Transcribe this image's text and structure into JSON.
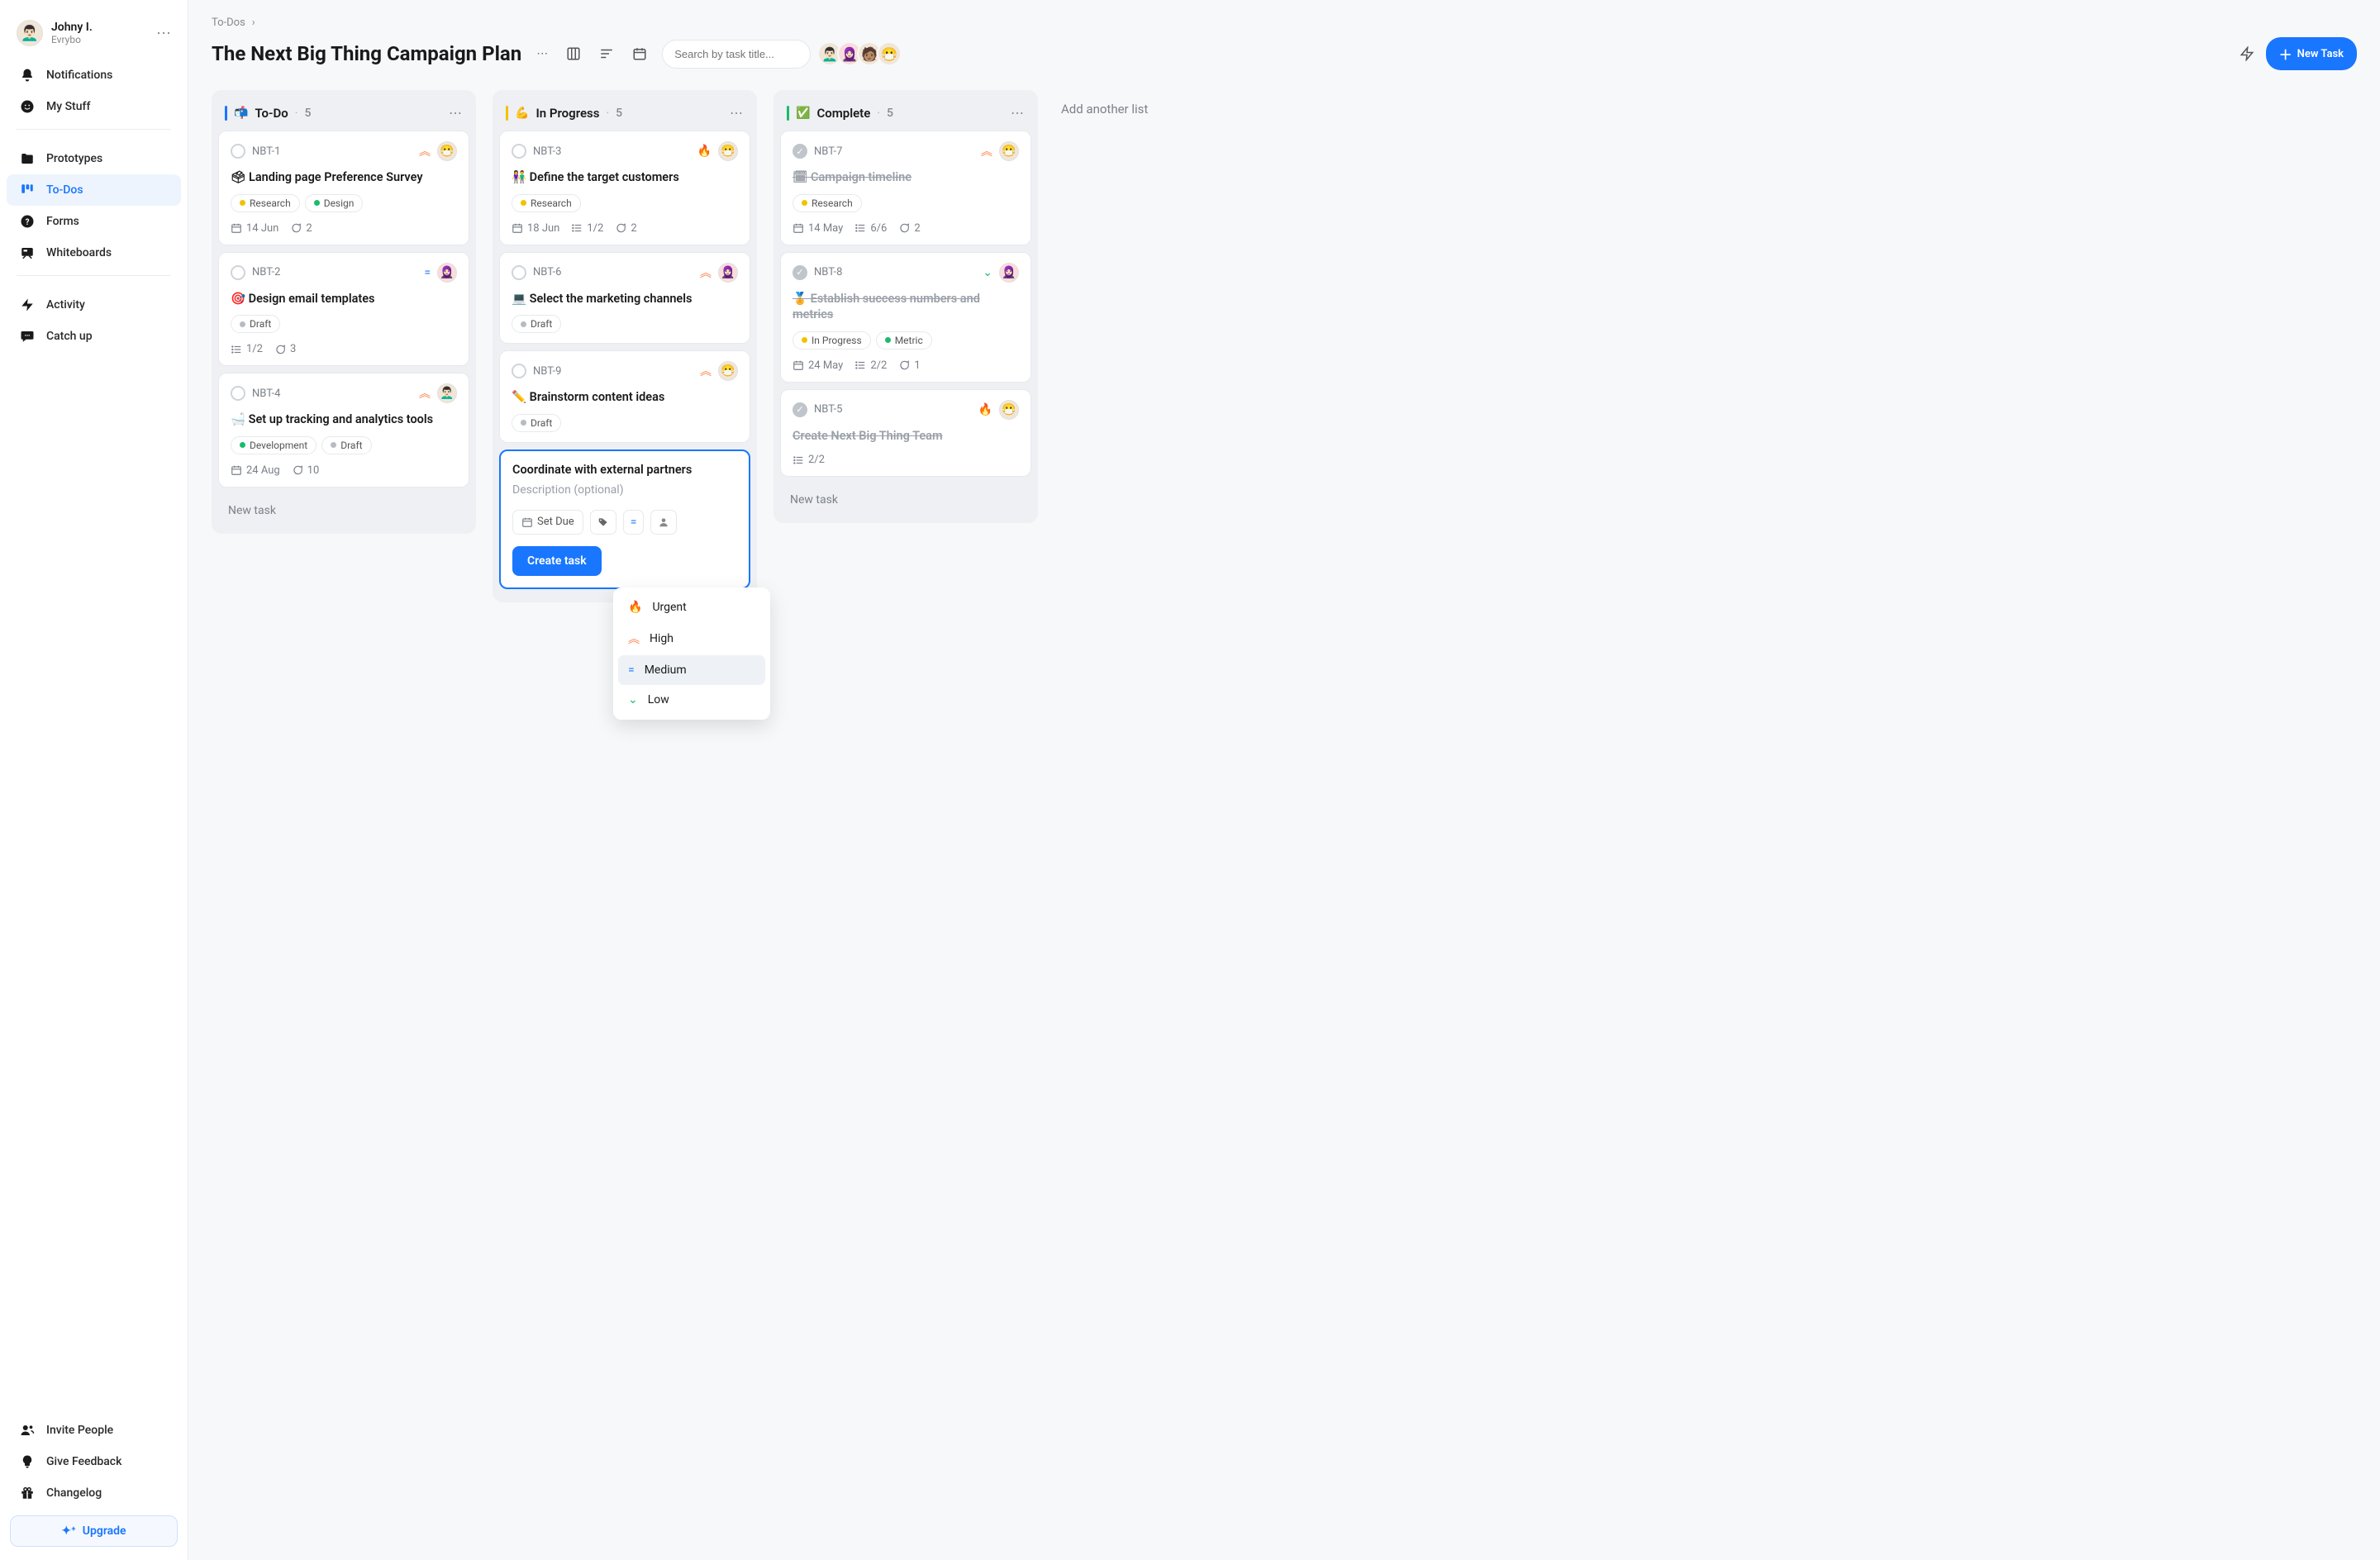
{
  "profile": {
    "name": "Johny I.",
    "org": "Evrybo",
    "emoji": "👨🏻‍🦱"
  },
  "sidebar": {
    "items": [
      {
        "label": "Notifications",
        "icon": "bell"
      },
      {
        "label": "My Stuff",
        "icon": "smile"
      },
      {
        "label": "Prototypes",
        "icon": "folder"
      },
      {
        "label": "To-Dos",
        "icon": "board",
        "active": true
      },
      {
        "label": "Forms",
        "icon": "question"
      },
      {
        "label": "Whiteboards",
        "icon": "whiteboard"
      },
      {
        "label": "Activity",
        "icon": "bolt"
      },
      {
        "label": "Catch up",
        "icon": "chat"
      }
    ],
    "footer": [
      {
        "label": "Invite People",
        "icon": "people"
      },
      {
        "label": "Give Feedback",
        "icon": "bulb"
      },
      {
        "label": "Changelog",
        "icon": "gift"
      }
    ],
    "upgrade": "Upgrade"
  },
  "breadcrumb": {
    "label": "To-Dos"
  },
  "header": {
    "title": "The Next Big Thing Campaign Plan",
    "search_placeholder": "Search by task title...",
    "new_task": "New Task",
    "avatars": [
      "👨🏻‍🦱",
      "🧕🏻",
      "🧑🏽",
      "😷"
    ]
  },
  "columns": [
    {
      "emoji": "📬",
      "title": "To-Do",
      "count": "5",
      "bar": "#1976ff",
      "cards": [
        {
          "id": "NBT-1",
          "title": "🗳 Landing page Preference Survey",
          "prio": "high",
          "prio_icon": "︽",
          "avatar": "😷",
          "tags": [
            {
              "label": "Research",
              "color": "#f2c200"
            },
            {
              "label": "Design",
              "color": "#1abc6b"
            }
          ],
          "meta": [
            {
              "icon": "cal",
              "text": "14 Jun"
            },
            {
              "icon": "comment",
              "text": "2"
            }
          ]
        },
        {
          "id": "NBT-2",
          "title": "🎯 Design email templates",
          "prio": "medium",
          "prio_icon": "=",
          "avatar": "🧕🏻",
          "avatar_red": true,
          "tags": [
            {
              "label": "Draft",
              "color": "#b7bbc2"
            }
          ],
          "meta": [
            {
              "icon": "list",
              "text": "1/2"
            },
            {
              "icon": "comment",
              "text": "3"
            }
          ]
        },
        {
          "id": "NBT-4",
          "title": "🛁 Set up tracking and analytics tools",
          "prio": "high",
          "prio_icon": "︽",
          "avatar": "👨🏻‍🦱",
          "tags": [
            {
              "label": "Development",
              "color": "#1abc6b"
            },
            {
              "label": "Draft",
              "color": "#b7bbc2"
            }
          ],
          "meta": [
            {
              "icon": "cal",
              "text": "24 Aug"
            },
            {
              "icon": "comment",
              "text": "10"
            }
          ]
        }
      ],
      "new_task": "New task"
    },
    {
      "emoji": "💪",
      "title": "In Progress",
      "count": "5",
      "bar": "#f2c200",
      "cards": [
        {
          "id": "NBT-3",
          "title": "👫 Define the target customers",
          "prio": "urgent",
          "prio_icon": "🔥",
          "avatar": "😷",
          "tags": [
            {
              "label": "Research",
              "color": "#f2c200"
            }
          ],
          "meta": [
            {
              "icon": "cal",
              "text": "18 Jun"
            },
            {
              "icon": "list",
              "text": "1/2"
            },
            {
              "icon": "comment",
              "text": "2"
            }
          ]
        },
        {
          "id": "NBT-6",
          "title": "💻 Select the marketing channels",
          "prio": "high",
          "prio_icon": "︽",
          "avatar": "🧕🏻",
          "avatar_red": true,
          "tags": [
            {
              "label": "Draft",
              "color": "#b7bbc2"
            }
          ],
          "meta": []
        },
        {
          "id": "NBT-9",
          "title": "✏️ Brainstorm content ideas",
          "prio": "high",
          "prio_icon": "︽",
          "avatar": "😷",
          "tags": [
            {
              "label": "Draft",
              "color": "#b7bbc2"
            }
          ],
          "meta": []
        }
      ],
      "compose": {
        "title": "Coordinate with external partners",
        "desc_placeholder": "Description (optional)",
        "set_due": "Set Due",
        "create": "Create task",
        "priority_options": [
          {
            "label": "Urgent",
            "class": "urgent",
            "icon": "🔥"
          },
          {
            "label": "High",
            "class": "high",
            "icon": "︽"
          },
          {
            "label": "Medium",
            "class": "medium",
            "icon": "=",
            "selected": true
          },
          {
            "label": "Low",
            "class": "low",
            "icon": "⌄"
          }
        ]
      }
    },
    {
      "emoji": "✅",
      "title": "Complete",
      "count": "5",
      "bar": "#1abc6b",
      "cards": [
        {
          "id": "NBT-7",
          "done": true,
          "title": "🗓 Campaign timeline",
          "prio": "high",
          "prio_icon": "︽",
          "avatar": "😷",
          "tags": [
            {
              "label": "Research",
              "color": "#f2c200"
            }
          ],
          "meta": [
            {
              "icon": "cal",
              "text": "14 May"
            },
            {
              "icon": "list",
              "text": "6/6"
            },
            {
              "icon": "comment",
              "text": "2"
            }
          ]
        },
        {
          "id": "NBT-8",
          "done": true,
          "title": "🏅 Establish success numbers and metrics",
          "prio": "low",
          "prio_icon": "⌄",
          "avatar": "🧕🏻",
          "avatar_red": true,
          "tags": [
            {
              "label": "In Progress",
              "color": "#f2c200"
            },
            {
              "label": "Metric",
              "color": "#1abc6b"
            }
          ],
          "meta": [
            {
              "icon": "cal",
              "text": "24 May"
            },
            {
              "icon": "list",
              "text": "2/2"
            },
            {
              "icon": "comment",
              "text": "1"
            }
          ]
        },
        {
          "id": "NBT-5",
          "done": true,
          "title": "Create Next Big Thing Team",
          "prio": "urgent",
          "prio_icon": "🔥",
          "avatar": "😷",
          "tags": [],
          "meta": [
            {
              "icon": "list",
              "text": "2/2"
            }
          ]
        }
      ],
      "new_task": "New task"
    }
  ],
  "add_list": "Add another list"
}
